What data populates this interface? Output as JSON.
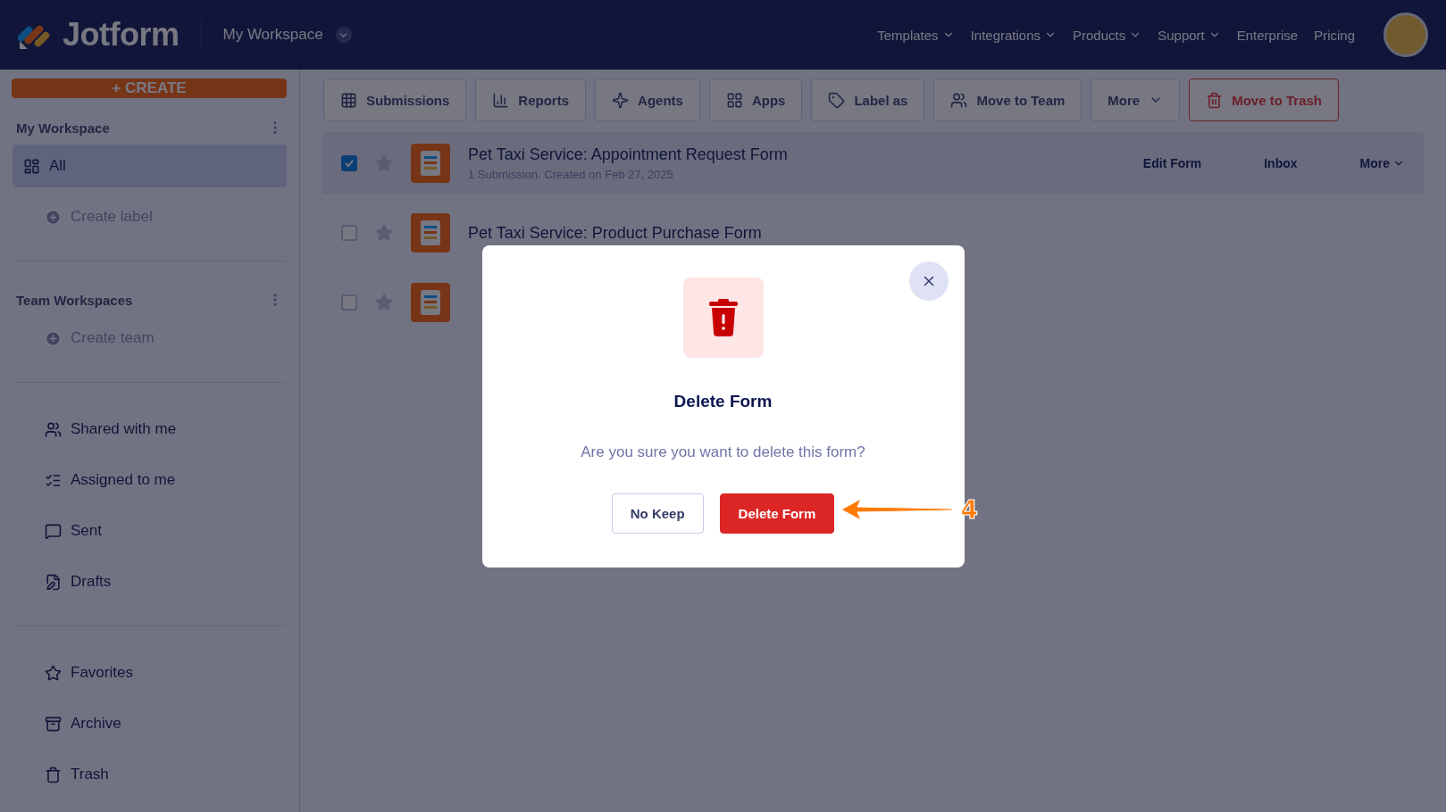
{
  "topbar": {
    "brand": "Jotform",
    "workspace": "My Workspace",
    "nav": [
      {
        "label": "Templates",
        "dropdown": true
      },
      {
        "label": "Integrations",
        "dropdown": true
      },
      {
        "label": "Products",
        "dropdown": true
      },
      {
        "label": "Support",
        "dropdown": true
      },
      {
        "label": "Enterprise",
        "dropdown": false
      },
      {
        "label": "Pricing",
        "dropdown": false
      }
    ]
  },
  "create_button": "+ CREATE",
  "toolbar": [
    {
      "label": "Submissions",
      "kind": "normal"
    },
    {
      "label": "Reports",
      "kind": "normal"
    },
    {
      "label": "Agents",
      "kind": "normal"
    },
    {
      "label": "Apps",
      "kind": "normal"
    },
    {
      "label": "Label as",
      "kind": "normal"
    },
    {
      "label": "Move to Team",
      "kind": "normal"
    },
    {
      "label": "More",
      "kind": "dropdown"
    },
    {
      "label": "Move to Trash",
      "kind": "danger"
    }
  ],
  "sidebar": {
    "sections": [
      {
        "title": "My Workspace",
        "items": [
          {
            "label": "All",
            "kind": "nav",
            "selected": true
          },
          {
            "label": "Create label",
            "kind": "add",
            "selected": false
          }
        ]
      },
      {
        "title": "Team Workspaces",
        "items": [
          {
            "label": "Create team",
            "kind": "add",
            "selected": false
          }
        ]
      },
      {
        "items": [
          {
            "label": "Shared with me",
            "kind": "nav",
            "selected": false
          },
          {
            "label": "Assigned to me",
            "kind": "nav",
            "selected": false
          },
          {
            "label": "Sent",
            "kind": "nav",
            "selected": false
          },
          {
            "label": "Drafts",
            "kind": "nav",
            "selected": false
          }
        ]
      },
      {
        "items": [
          {
            "label": "Favorites",
            "kind": "nav",
            "selected": false
          },
          {
            "label": "Archive",
            "kind": "nav",
            "selected": false
          },
          {
            "label": "Trash",
            "kind": "nav",
            "selected": false
          }
        ]
      }
    ]
  },
  "forms": [
    {
      "title": "Pet Taxi Service: Appointment Request Form",
      "subtitle": "1 Submission. Created on Feb 27, 2025",
      "checked": true,
      "actions": [
        "Edit Form",
        "Inbox",
        "More"
      ]
    },
    {
      "title": "Pet Taxi Service: Product Purchase Form",
      "checked": false
    },
    {
      "checked": false
    }
  ],
  "dialog": {
    "title": "Delete Form",
    "message": "Are you sure you want to delete this form?",
    "buttons": [
      {
        "label": "No Keep",
        "kind": "secondary"
      },
      {
        "label": "Delete Form",
        "kind": "primary"
      }
    ]
  },
  "annotation": {
    "label": "4"
  }
}
